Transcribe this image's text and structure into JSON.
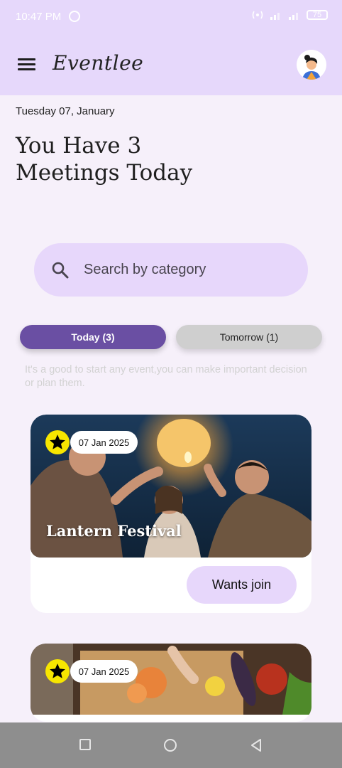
{
  "status_bar": {
    "time": "10:47 PM",
    "battery": "75"
  },
  "app_bar": {
    "brand": "Eventlee"
  },
  "date_line": "Tuesday 07, January",
  "headline": "You Have 3 Meetings Today",
  "search": {
    "placeholder": "Search by category"
  },
  "tabs": [
    {
      "label": "Today (3)",
      "active": true
    },
    {
      "label": "Tomorrow (1)",
      "active": false
    }
  ],
  "hint": "It's a good to start any event,you can make important decision or plan them.",
  "events": [
    {
      "date": "07 Jan 2025",
      "title": "Lantern Festival",
      "action": "Wants join"
    },
    {
      "date": "07 Jan 2025"
    }
  ],
  "colors": {
    "accent": "#6a4fa3",
    "app_bar": "#e6d8fb",
    "chip_bg": "#e7d7fb",
    "star": "#f7e600"
  },
  "icons": [
    "menu-icon",
    "search-icon",
    "star-icon",
    "nav-square-icon",
    "nav-circle-icon",
    "nav-back-icon"
  ]
}
